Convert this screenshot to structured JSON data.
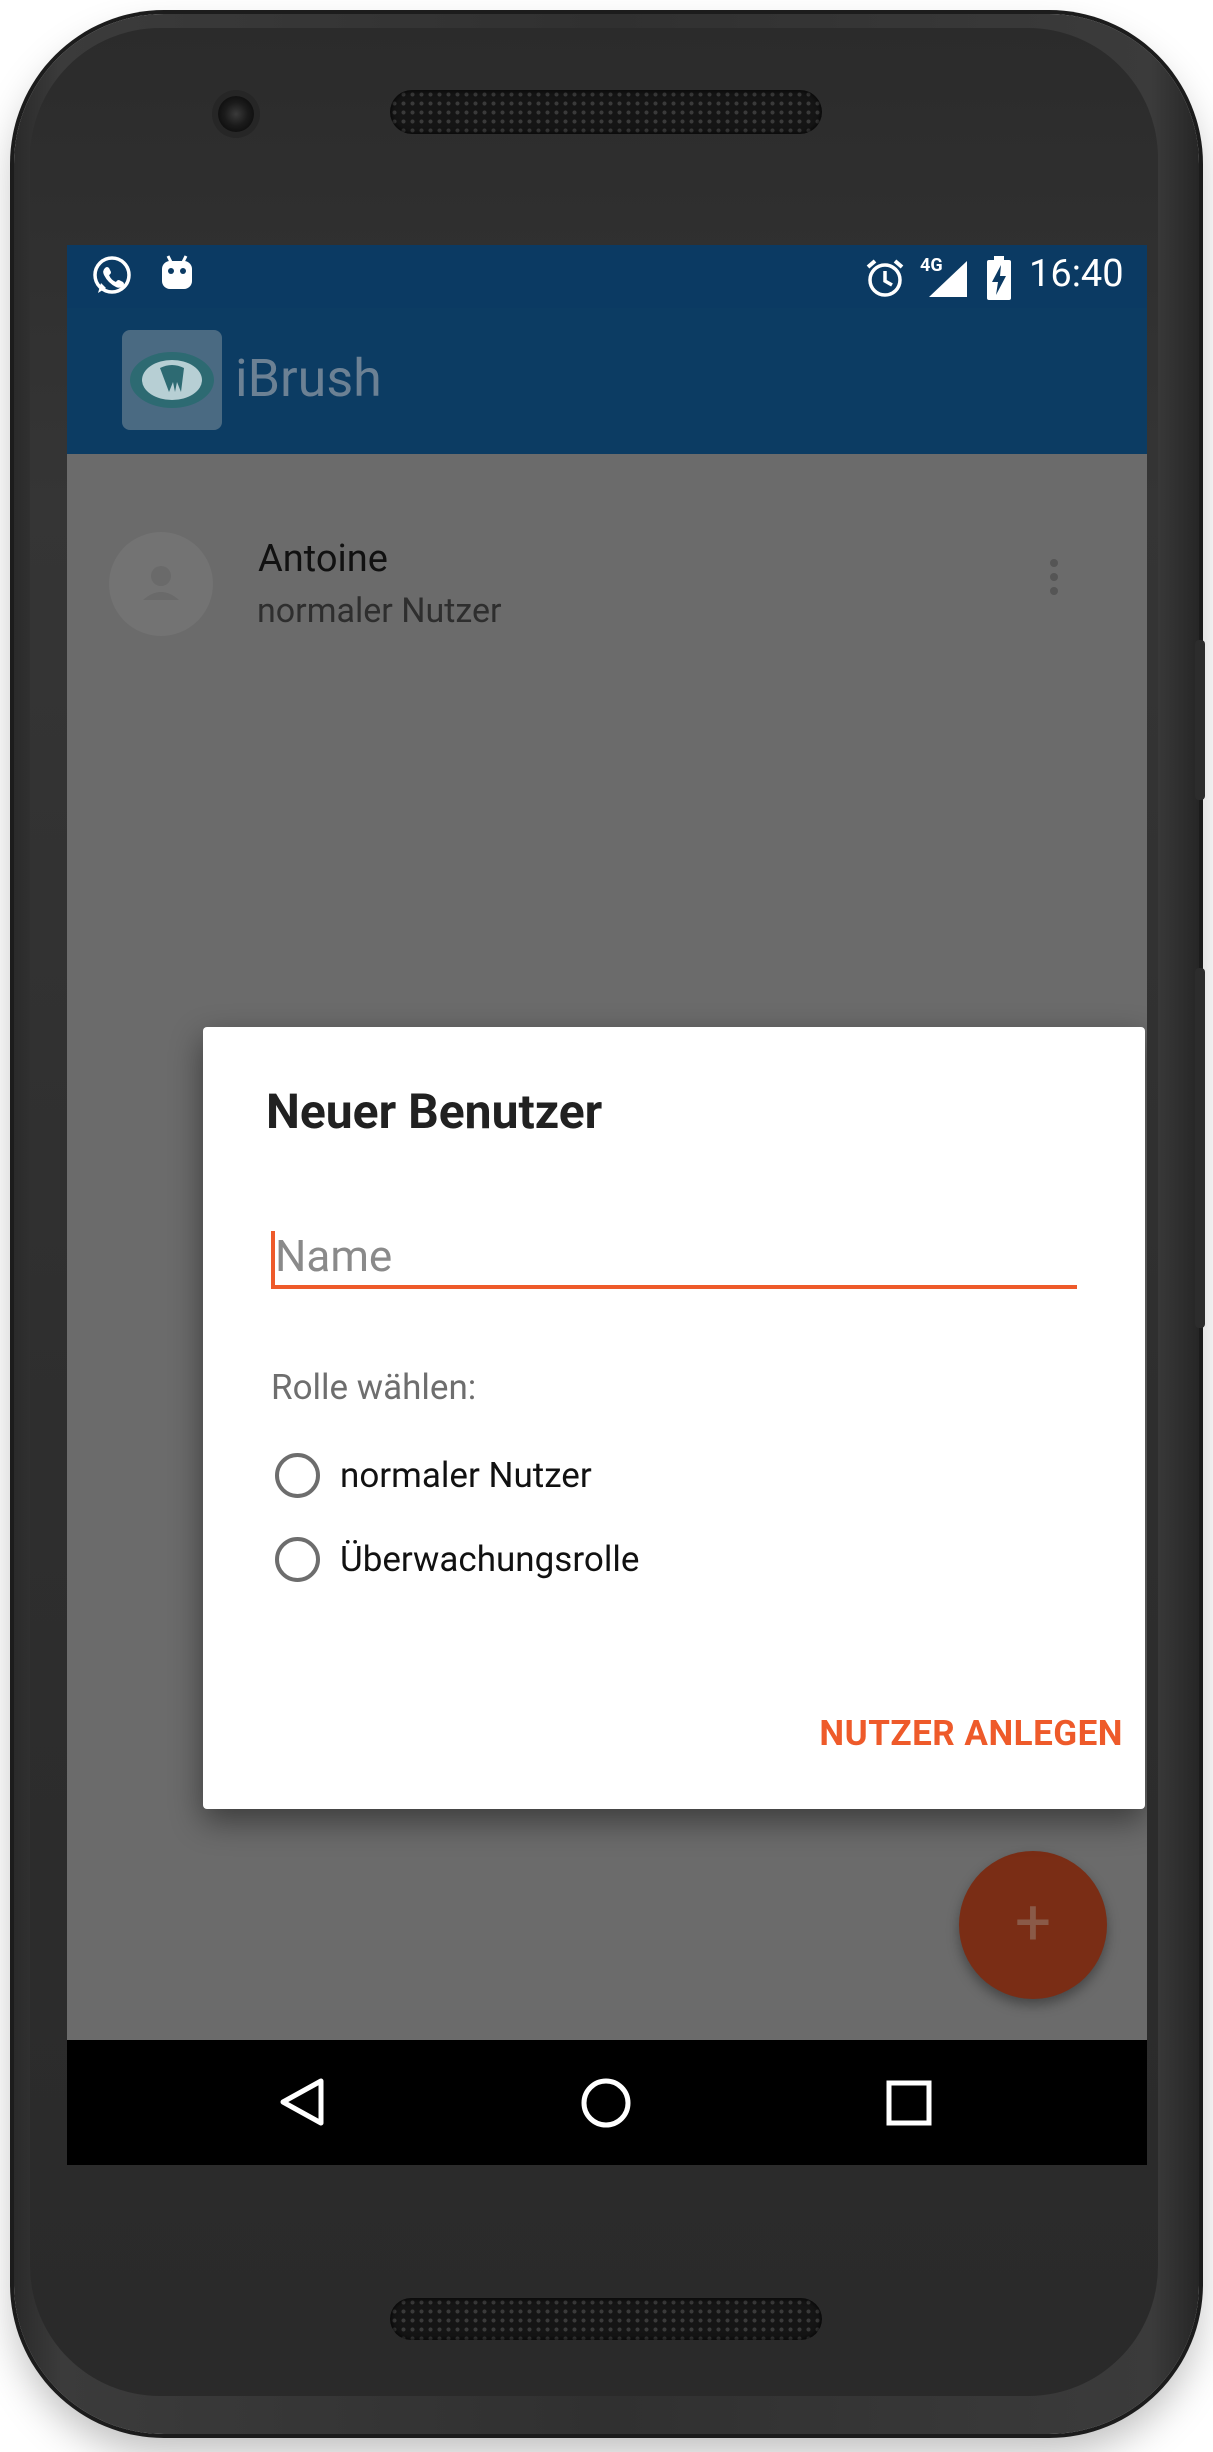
{
  "status_bar": {
    "time": "16:40",
    "network": "4G",
    "icons": [
      "whatsapp-icon",
      "android-icon",
      "alarm-icon",
      "signal-icon",
      "battery-charging-icon"
    ]
  },
  "app_bar": {
    "title": "iBrush",
    "logo": "tooth-logo-icon"
  },
  "user_list": [
    {
      "name": "Antoine",
      "role": "normaler Nutzer"
    }
  ],
  "fab": {
    "label": "+"
  },
  "dialog": {
    "title": "Neuer Benutzer",
    "name_field": {
      "placeholder": "Name",
      "value": ""
    },
    "role_label": "Rolle wählen:",
    "roles": [
      {
        "label": "normaler Nutzer",
        "selected": false
      },
      {
        "label": "Überwachungsrolle",
        "selected": false
      }
    ],
    "action_label": "NUTZER ANLEGEN"
  },
  "nav_bar": {
    "icons": [
      "back-icon",
      "home-icon",
      "recents-icon"
    ]
  },
  "colors": {
    "accent": "#EE5A2A",
    "app_bar": "#0C3C63",
    "status_bar": "#0B3A63",
    "fab": "#7A2D15"
  }
}
